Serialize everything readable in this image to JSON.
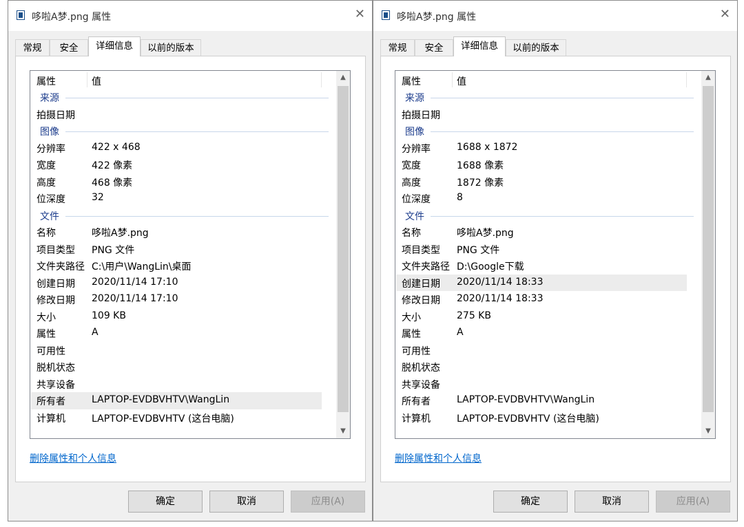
{
  "columns": {
    "property": "属性",
    "value": "值"
  },
  "link": "删除属性和个人信息",
  "buttons": {
    "ok": "确定",
    "cancel": "取消",
    "apply": "应用(A)"
  },
  "tabs": [
    "常规",
    "安全",
    "详细信息",
    "以前的版本"
  ],
  "close_glyph": "✕",
  "dialogs": [
    {
      "title": "哆啦A梦.png 属性",
      "rows": [
        {
          "kind": "group",
          "label": "来源"
        },
        {
          "label": "拍摄日期",
          "value": ""
        },
        {
          "kind": "group",
          "label": "图像"
        },
        {
          "label": "分辨率",
          "value": "422 x 468"
        },
        {
          "label": "宽度",
          "value": "422 像素"
        },
        {
          "label": "高度",
          "value": "468 像素"
        },
        {
          "label": "位深度",
          "value": "32"
        },
        {
          "kind": "group",
          "label": "文件"
        },
        {
          "label": "名称",
          "value": "哆啦A梦.png"
        },
        {
          "label": "项目类型",
          "value": "PNG 文件"
        },
        {
          "label": "文件夹路径",
          "value": "C:\\用户\\WangLin\\桌面"
        },
        {
          "label": "创建日期",
          "value": "2020/11/14 17:10"
        },
        {
          "label": "修改日期",
          "value": "2020/11/14 17:10"
        },
        {
          "label": "大小",
          "value": "109 KB"
        },
        {
          "label": "属性",
          "value": "A"
        },
        {
          "label": "可用性",
          "value": ""
        },
        {
          "label": "脱机状态",
          "value": ""
        },
        {
          "label": "共享设备",
          "value": ""
        },
        {
          "label": "所有者",
          "value": "LAPTOP-EVDBVHTV\\WangLin",
          "highlighted": true
        },
        {
          "label": "计算机",
          "value": "LAPTOP-EVDBVHTV (这台电脑)"
        }
      ]
    },
    {
      "title": "哆啦A梦.png 属性",
      "rows": [
        {
          "kind": "group",
          "label": "来源"
        },
        {
          "label": "拍摄日期",
          "value": ""
        },
        {
          "kind": "group",
          "label": "图像"
        },
        {
          "label": "分辨率",
          "value": "1688 x 1872"
        },
        {
          "label": "宽度",
          "value": "1688 像素"
        },
        {
          "label": "高度",
          "value": "1872 像素"
        },
        {
          "label": "位深度",
          "value": "8"
        },
        {
          "kind": "group",
          "label": "文件"
        },
        {
          "label": "名称",
          "value": "哆啦A梦.png"
        },
        {
          "label": "项目类型",
          "value": "PNG 文件"
        },
        {
          "label": "文件夹路径",
          "value": "D:\\Google下载"
        },
        {
          "label": "创建日期",
          "value": "2020/11/14 18:33",
          "highlighted": true
        },
        {
          "label": "修改日期",
          "value": "2020/11/14 18:33"
        },
        {
          "label": "大小",
          "value": "275 KB"
        },
        {
          "label": "属性",
          "value": "A"
        },
        {
          "label": "可用性",
          "value": ""
        },
        {
          "label": "脱机状态",
          "value": ""
        },
        {
          "label": "共享设备",
          "value": ""
        },
        {
          "label": "所有者",
          "value": "LAPTOP-EVDBVHTV\\WangLin"
        },
        {
          "label": "计算机",
          "value": "LAPTOP-EVDBVHTV (这台电脑)"
        }
      ]
    }
  ]
}
